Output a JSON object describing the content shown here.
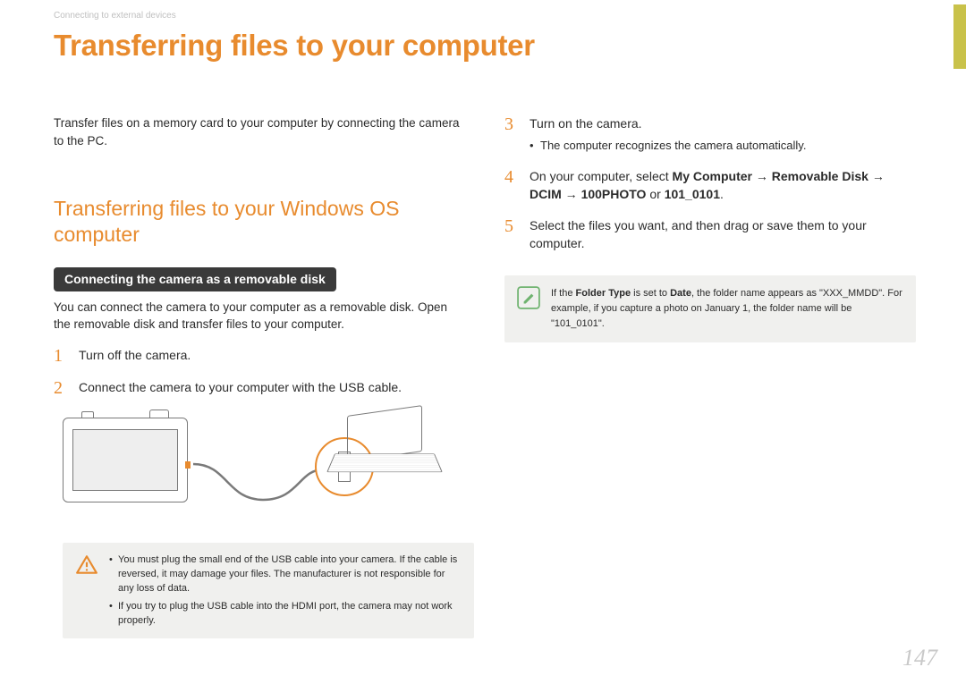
{
  "breadcrumb": "Connecting to external devices",
  "title": "Transferring files to your computer",
  "page_number": "147",
  "left": {
    "intro": "Transfer files on a memory card to your computer by connecting the camera to the PC.",
    "section_heading": "Transferring files to your Windows OS computer",
    "pill": "Connecting the camera as a removable disk",
    "body": "You can connect the camera to your computer as a removable disk. Open the removable disk and transfer files to your computer.",
    "steps": {
      "s1": {
        "num": "1",
        "text": "Turn off the camera."
      },
      "s2": {
        "num": "2",
        "text": "Connect the camera to your computer with the USB cable."
      }
    },
    "caution": {
      "b1": "You must plug the small end of the USB cable into your camera. If the cable is reversed, it may damage your files. The manufacturer is not responsible for any loss of data.",
      "b2": "If you try to plug the USB cable into the HDMI port, the camera may not work properly."
    }
  },
  "right": {
    "steps": {
      "s3": {
        "num": "3",
        "text": "Turn on the camera.",
        "sub": "The computer recognizes the camera automatically."
      },
      "s4": {
        "num": "4",
        "pre": "On your computer, select ",
        "bold1": "My Computer",
        "arr1": " → ",
        "bold2": "Removable Disk",
        "arr2": " → ",
        "bold3": "DCIM",
        "arr3": " → ",
        "bold4": "100PHOTO",
        "mid": " or ",
        "bold5": "101_0101",
        "suf": "."
      },
      "s5": {
        "num": "5",
        "text": "Select the files you want, and then drag or save them to your computer."
      }
    },
    "note": {
      "p1a": "If the ",
      "p1b": "Folder Type",
      "p1c": " is set to ",
      "p1d": "Date",
      "p1e": ", the folder name appears as \"XXX_MMDD\". For example, if you capture a photo on January 1, the folder name will be \"101_0101\"."
    }
  }
}
